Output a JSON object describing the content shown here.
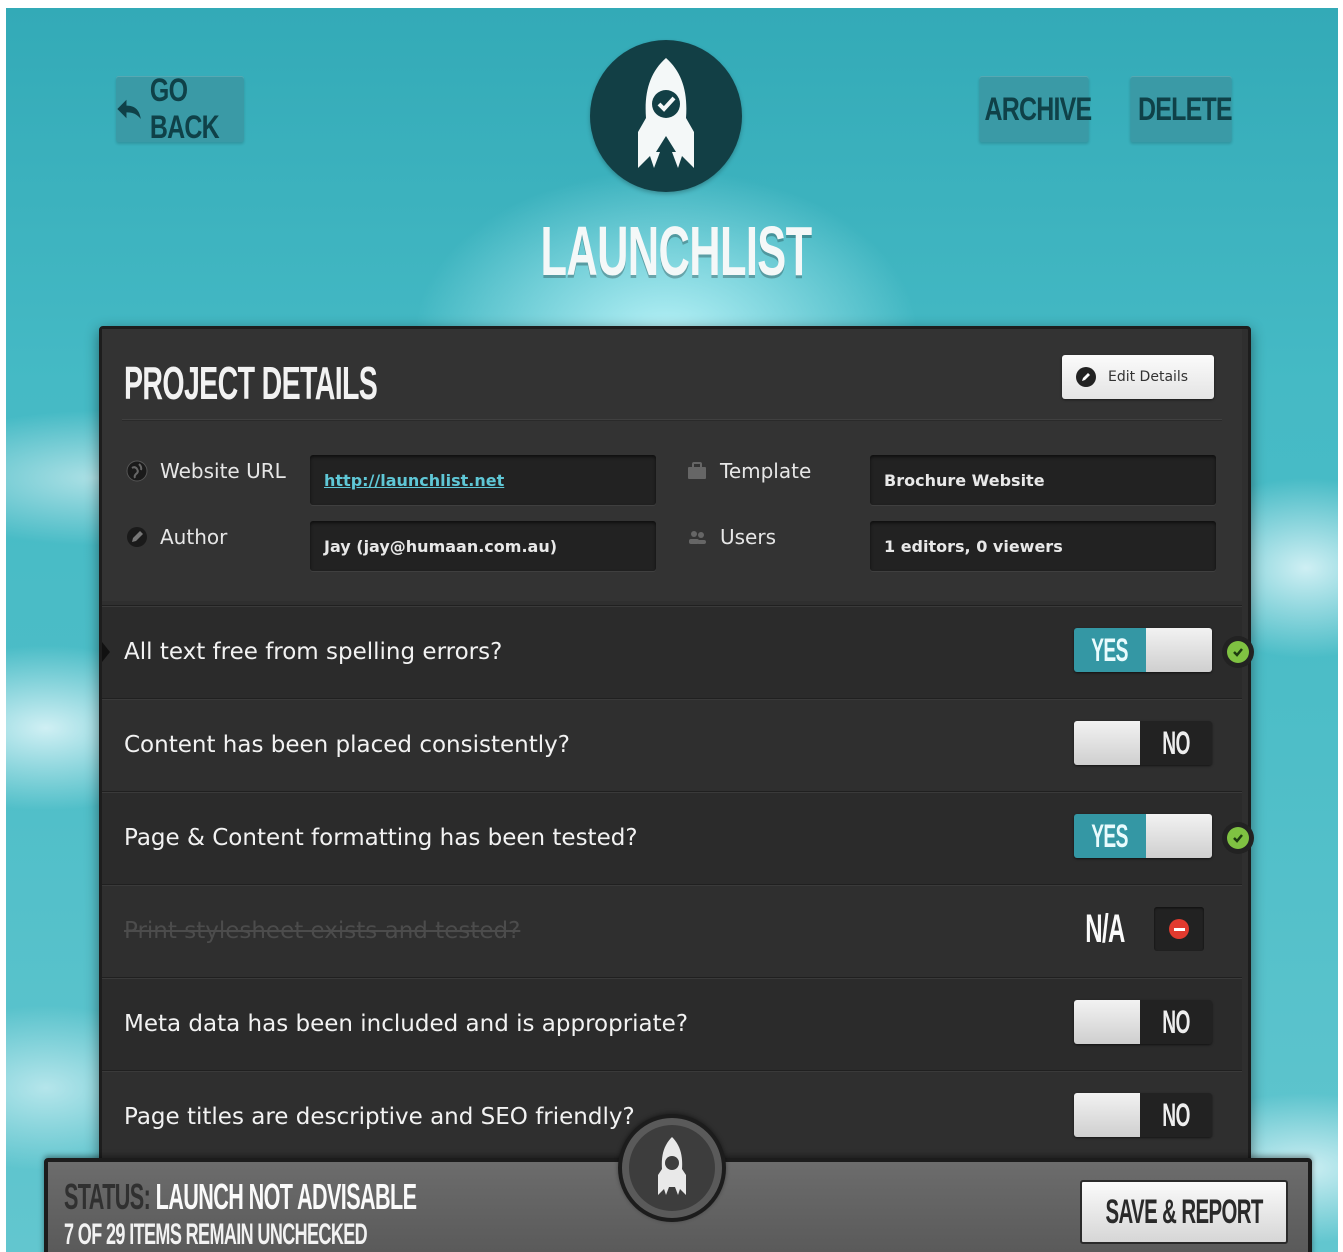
{
  "header": {
    "back_label": "GO BACK",
    "archive_label": "ARCHIVE",
    "delete_label": "DELETE",
    "app_title": "LAUNCHLIST"
  },
  "details": {
    "title": "PROJECT DETAILS",
    "edit_label": "Edit Details",
    "fields": [
      {
        "label": "Website URL",
        "value": "http://launchlist.net",
        "icon": "globe-icon"
      },
      {
        "label": "Author",
        "value": "Jay (jay@humaan.com.au)",
        "icon": "pencil-icon"
      },
      {
        "label": "Template",
        "value": "Brochure Website",
        "icon": "briefcase-icon"
      },
      {
        "label": "Users",
        "value": "1 editors, 0 viewers",
        "icon": "users-icon"
      }
    ]
  },
  "checklist": [
    {
      "question": "All text free from spelling errors?",
      "state": "yes",
      "label": "YES"
    },
    {
      "question": "Content has been placed consistently?",
      "state": "no",
      "label": "NO"
    },
    {
      "question": "Page & Content formatting has been tested?",
      "state": "yes",
      "label": "YES"
    },
    {
      "question": "Print stylesheet exists and tested?",
      "state": "na",
      "label": "N/A"
    },
    {
      "question": "Meta data has been included and is appropriate?",
      "state": "no",
      "label": "NO"
    },
    {
      "question": "Page titles are descriptive and SEO friendly?",
      "state": "no",
      "label": "NO"
    }
  ],
  "status": {
    "prefix": "STATUS:",
    "value": "LAUNCH NOT ADVISABLE",
    "remaining": "7 OF 29 ITEMS REMAIN UNCHECKED",
    "save_label": "SAVE & REPORT"
  },
  "colors": {
    "sky": "#4cbdc7",
    "panel": "#2f2f2f",
    "accent": "#3497a4",
    "check": "#7fc242",
    "na": "#e23a2e"
  }
}
